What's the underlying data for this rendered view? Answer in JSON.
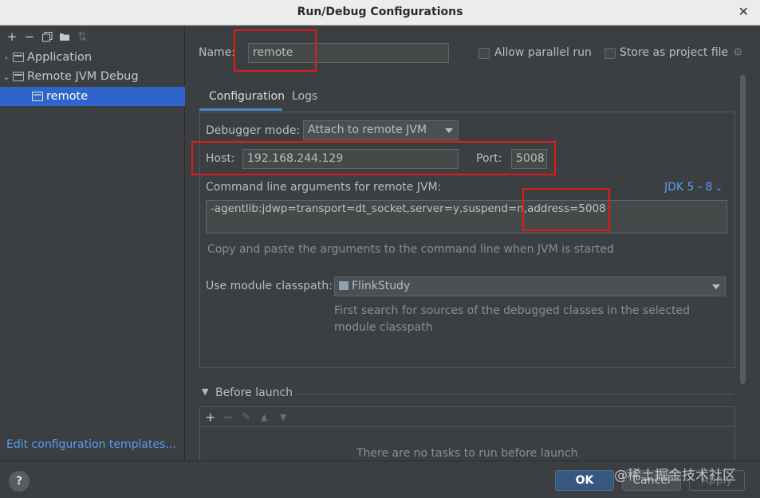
{
  "window": {
    "title": "Run/Debug Configurations",
    "close_glyph": "✕"
  },
  "toolbar": {
    "icons": [
      "add-icon",
      "remove-icon",
      "copy-icon",
      "folder-add-icon",
      "sort-icon"
    ]
  },
  "tree": {
    "items": [
      {
        "label": "Application"
      },
      {
        "label": "Remote JVM Debug"
      },
      {
        "label": "remote"
      }
    ]
  },
  "left_footer": {
    "edit_templates": "Edit configuration templates..."
  },
  "form": {
    "name_label": "Name:",
    "name_value": "remote",
    "allow_parallel_label": "Allow parallel run",
    "store_project_label": "Store as project file",
    "tabs": [
      {
        "label": "Configuration"
      },
      {
        "label": "Logs"
      }
    ],
    "debugger_mode_label": "Debugger mode:",
    "debugger_mode_value": "Attach to remote JVM",
    "host_label": "Host:",
    "host_value": "192.168.244.129",
    "port_label": "Port:",
    "port_value": "5008",
    "cmd_label": "Command line arguments for remote JVM:",
    "jdk_link": "JDK 5 - 8",
    "cmd_value": "-agentlib:jdwp=transport=dt_socket,server=y,suspend=n,address=5008",
    "cmd_hint": "Copy and paste the arguments to the command line when JVM is started",
    "module_label": "Use module classpath:",
    "module_value": "FlinkStudy",
    "module_hint_1": "First search for sources of the debugged classes in the selected",
    "module_hint_2": "module classpath",
    "before_launch_label": "Before launch",
    "before_launch_empty": "There are no tasks to run before launch"
  },
  "buttons": {
    "ok": "OK",
    "cancel": "Cancel",
    "apply": "Apply",
    "help": "?"
  },
  "watermark": "@稀土掘金技术社区",
  "colors": {
    "accent": "#2f65ca",
    "link": "#589df6",
    "highlight_box": "#e01b1b",
    "ok_button": "#365880"
  }
}
